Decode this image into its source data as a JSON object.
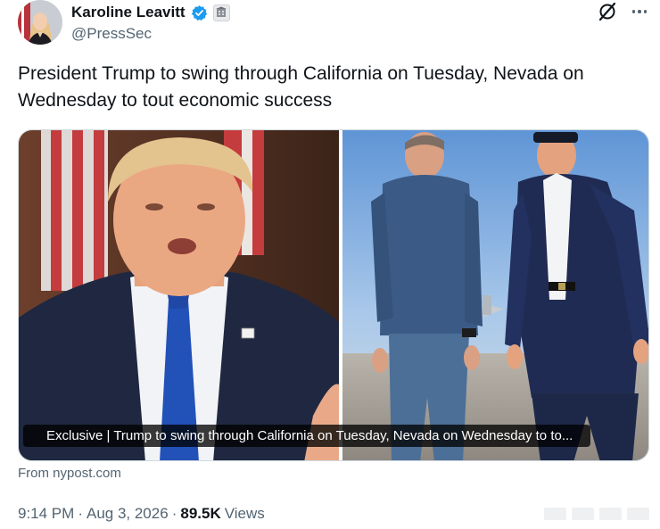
{
  "author": {
    "name": "Karoline Leavitt",
    "handle": "@PressSec",
    "verified_color": "#1d9bf0"
  },
  "icons": {
    "grok": "grok-icon",
    "more": "more-options-icon",
    "verified": "verified-badge-icon",
    "government": "government-badge-icon"
  },
  "tweet": {
    "text": "President Trump to swing through California on Tuesday, Nevada on Wednesday to tout economic success"
  },
  "card": {
    "caption": "Exclusive | Trump to swing through California on Tuesday, Nevada on Wednesday to to...",
    "source": "From nypost.com"
  },
  "meta": {
    "time": "9:14 PM",
    "date": "Aug 3, 2026",
    "views_count": "89.5K",
    "views_label": "Views",
    "separator": "·"
  }
}
